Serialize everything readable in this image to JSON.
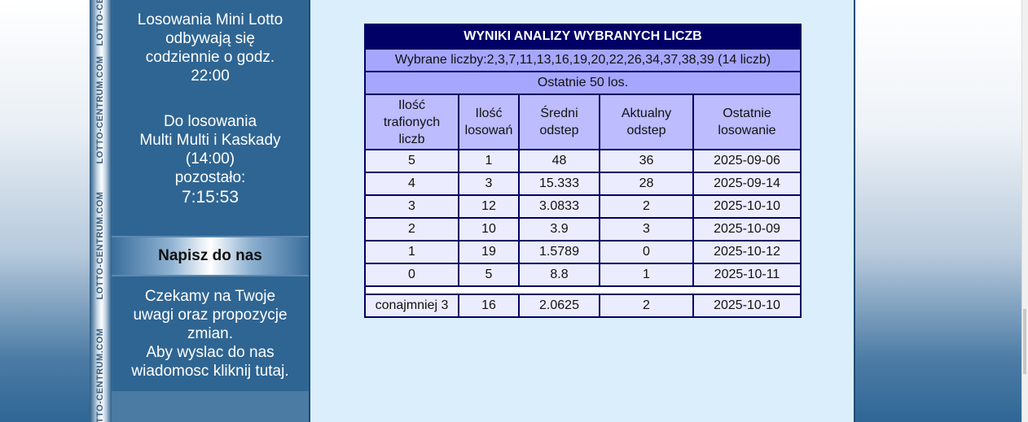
{
  "sidebar": {
    "strip_text": "LOTTO-CENTRUM.COM",
    "mini_lotto_info": [
      "Losowania Mini Lotto",
      "odbywają się",
      "codziennie o godz.",
      "22:00"
    ],
    "countdown": {
      "lines": [
        "Do losowania",
        "Multi Multi i Kaskady",
        "(14:00)",
        "pozostało:"
      ],
      "time": "7:15:53"
    },
    "contact": {
      "header": "Napisz do nas",
      "lines": [
        "Czekamy na Twoje",
        "uwagi oraz propozycje",
        "zmian.",
        "Aby wyslac do nas",
        "wiadomosc kliknij tutaj."
      ]
    }
  },
  "results": {
    "title": "WYNIKI ANALIZY WYBRANYCH LICZB",
    "selected": "Wybrane liczby:2,3,7,11,13,16,19,20,22,26,34,37,38,39 (14 liczb)",
    "last_draws": "Ostatnie 50 los.",
    "headers": [
      [
        "Ilość",
        "trafionych",
        "liczb"
      ],
      [
        "Ilość",
        "losowań"
      ],
      [
        "Średni",
        "odstep"
      ],
      [
        "Aktualny",
        "odstep"
      ],
      [
        "Ostatnie",
        "losowanie"
      ]
    ],
    "rows": [
      [
        "5",
        "1",
        "48",
        "36",
        "2025-09-06"
      ],
      [
        "4",
        "3",
        "15.333",
        "28",
        "2025-09-14"
      ],
      [
        "3",
        "12",
        "3.0833",
        "2",
        "2025-10-10"
      ],
      [
        "2",
        "10",
        "3.9",
        "3",
        "2025-10-09"
      ],
      [
        "1",
        "19",
        "1.5789",
        "0",
        "2025-10-12"
      ],
      [
        "0",
        "5",
        "8.8",
        "1",
        "2025-10-11"
      ]
    ],
    "summary": [
      "conajmniej 3",
      "16",
      "2.0625",
      "2",
      "2025-10-10"
    ]
  }
}
